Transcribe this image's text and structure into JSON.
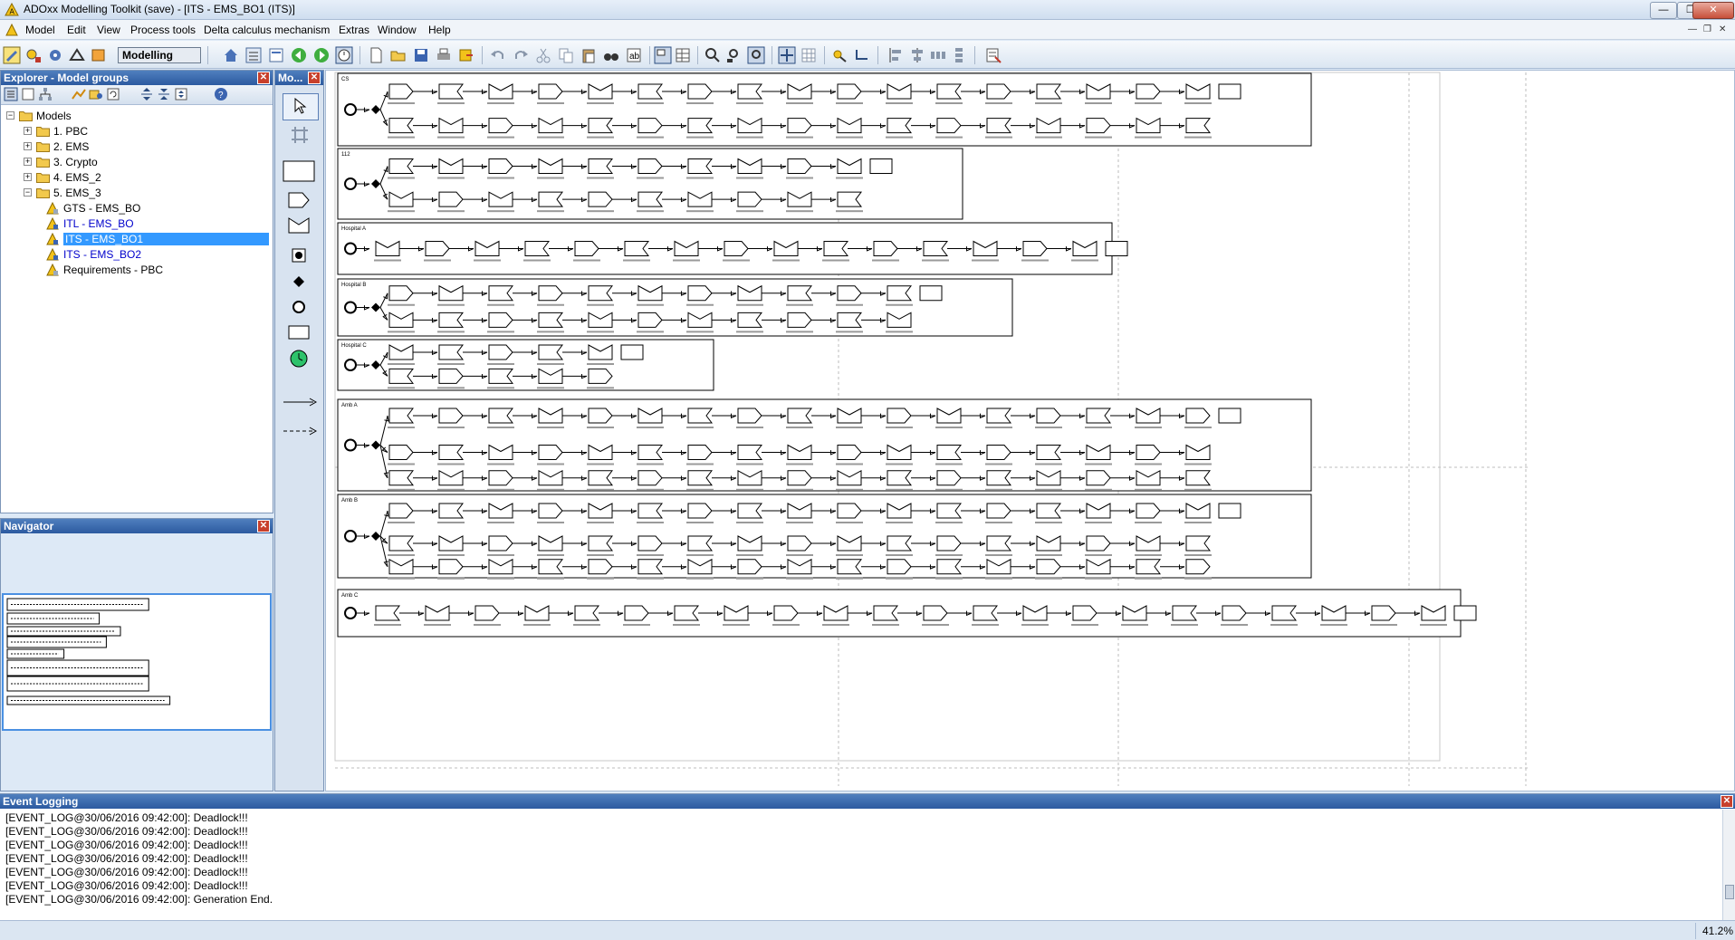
{
  "window": {
    "title": "ADOxx Modelling Toolkit (save) - [ITS - EMS_BO1 (ITS)]"
  },
  "menu": [
    "Model",
    "Edit",
    "View",
    "Process tools",
    "Delta calculus mechanism",
    "Extras",
    "Window",
    "Help"
  ],
  "toolbar": {
    "mode": "Modelling"
  },
  "explorer": {
    "title": "Explorer - Model groups",
    "tree": [
      {
        "label": "Models",
        "level": 0,
        "expander": "minus",
        "kind": "folder"
      },
      {
        "label": "1. PBC",
        "level": 1,
        "expander": "plus",
        "kind": "folder"
      },
      {
        "label": "2. EMS",
        "level": 1,
        "expander": "plus",
        "kind": "folder"
      },
      {
        "label": "3. Crypto",
        "level": 1,
        "expander": "plus",
        "kind": "folder"
      },
      {
        "label": "4. EMS_2",
        "level": 1,
        "expander": "plus",
        "kind": "folder"
      },
      {
        "label": "5. EMS_3",
        "level": 1,
        "expander": "minus",
        "kind": "folder"
      },
      {
        "label": "GTS - EMS_BO",
        "level": 2,
        "kind": "model",
        "open": false,
        "selected": false
      },
      {
        "label": "ITL - EMS_BO",
        "level": 2,
        "kind": "model",
        "open": true,
        "selected": false
      },
      {
        "label": "ITS - EMS_BO1",
        "level": 2,
        "kind": "model",
        "open": true,
        "selected": true
      },
      {
        "label": "ITS - EMS_BO2",
        "level": 2,
        "kind": "model",
        "open": true,
        "selected": false
      },
      {
        "label": "Requirements - PBC",
        "level": 2,
        "kind": "model",
        "open": false,
        "selected": false
      }
    ]
  },
  "modelling_bar": {
    "title": "Mo..."
  },
  "navigator": {
    "title": "Navigator"
  },
  "canvas": {
    "lanes": [
      {
        "label": "CS",
        "rows": 2,
        "width_units": 19
      },
      {
        "label": "112",
        "rows": 2,
        "width_units": 12
      },
      {
        "label": "Hospital A",
        "rows": 1,
        "width_units": 15
      },
      {
        "label": "Hospital B",
        "rows": 2,
        "width_units": 13
      },
      {
        "label": "Hospital C",
        "rows": 2,
        "width_units": 7
      },
      {
        "label": "Amb A",
        "rows": 3,
        "width_units": 19
      },
      {
        "label": "Amb B",
        "rows": 3,
        "width_units": 19
      },
      {
        "label": "Amb C",
        "rows": 1,
        "width_units": 22
      }
    ]
  },
  "log": {
    "title": "Event Logging",
    "lines": [
      "[EVENT_LOG@30/06/2016 09:42:00]: Deadlock!!!",
      "[EVENT_LOG@30/06/2016 09:42:00]: Deadlock!!!",
      "[EVENT_LOG@30/06/2016 09:42:00]: Deadlock!!!",
      "[EVENT_LOG@30/06/2016 09:42:00]: Deadlock!!!",
      "[EVENT_LOG@30/06/2016 09:42:00]: Deadlock!!!",
      "[EVENT_LOG@30/06/2016 09:42:00]: Deadlock!!!",
      "[EVENT_LOG@30/06/2016 09:42:00]: Generation End."
    ]
  },
  "status": {
    "zoom": "41.2%"
  }
}
